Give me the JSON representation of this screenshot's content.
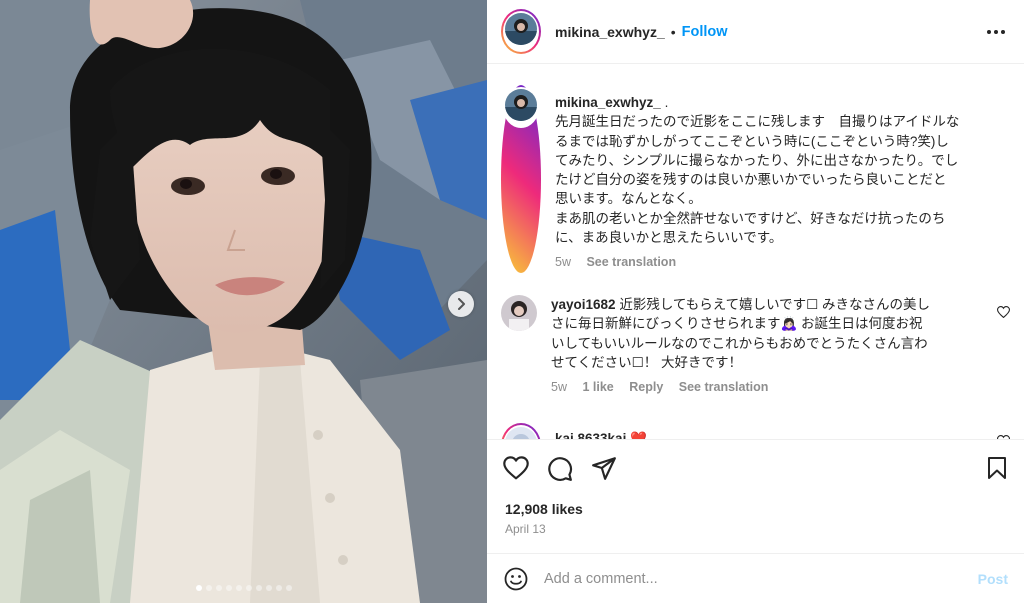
{
  "post": {
    "username": "mikina_exwhyz_",
    "separator": "•",
    "follow_label": "Follow",
    "more_icon": "more-horizontal-icon"
  },
  "caption": {
    "username": "mikina_exwhyz_",
    "after_username": ".",
    "text_lines": [
      "先月誕生日だったので近影をここに残します　自撮りはアイドルな",
      "るまでは恥ずかしがってここぞという時に(ここぞという時?笑)し",
      "てみたり、シンプルに撮らなかったり、外に出さなかったり。でし",
      "たけど自分の姿を残すのは良いか悪いかでいったら良いことだと",
      "思います。なんとなく。",
      "まあ肌の老いとか全然許せないですけど、好きなだけ抗ったのち",
      "に、まあ良いかと思えたらいいです。"
    ],
    "time": "5w",
    "see_translation": "See translation"
  },
  "comments": [
    {
      "username": "yayoi1682",
      "text_lines": [
        "近影残してもらえて嬉しいです☐ みきなさんの美し",
        "さに毎日新鮮にびっくりさせられます🙇🏻‍♀️ お誕生日は何度お祝",
        "いしてもいいルールなのでこれからもおめでとうたくさん言わ",
        "せてください☐！ 大好きです！"
      ],
      "time": "5w",
      "likes": "1 like",
      "reply": "Reply",
      "see_translation": "See translation"
    },
    {
      "username": "kai.8633kai",
      "emoji": "❤️"
    }
  ],
  "actions": {
    "like_icon": "heart-icon",
    "comment_icon": "comment-icon",
    "share_icon": "share-icon",
    "save_icon": "bookmark-icon"
  },
  "likes": "12,908 likes",
  "date": "April 13",
  "add_comment": {
    "placeholder": "Add a comment...",
    "post_label": "Post",
    "emoji_icon": "emoji-icon"
  },
  "carousel": {
    "dots_total": 10,
    "active_index": 0,
    "next_icon": "chevron-right-icon"
  },
  "colors": {
    "accent": "#0095f6",
    "post_disabled": "#b2dffc",
    "secondary_text": "#8e8e8e"
  }
}
